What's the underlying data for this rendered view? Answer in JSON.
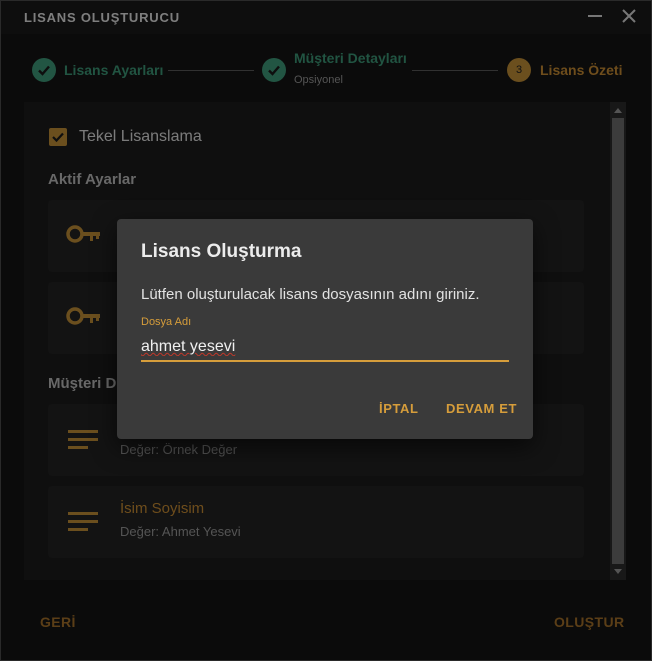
{
  "window": {
    "title": "LISANS OLUŞTURUCU"
  },
  "stepper": {
    "steps": [
      {
        "label": "Lisans Ayarları",
        "status": "done"
      },
      {
        "label": "Müşteri Detayları",
        "sub": "Opsiyonel",
        "status": "done"
      },
      {
        "label": "Lisans Özeti",
        "number": "3",
        "status": "active"
      }
    ]
  },
  "content": {
    "checkbox_label": "Tekel Lisanslama",
    "checkbox_checked": true,
    "active_settings_title": "Aktif Ayarlar",
    "customer_details_title": "Müşteri Detayları",
    "customer_cards": [
      {
        "title": "",
        "value": "Değer: Örnek Değer",
        "icon": "notes-icon"
      },
      {
        "title": "İsim Soyisim",
        "value": "Değer: Ahmet Yesevi",
        "icon": "notes-icon"
      }
    ],
    "settings_cards": [
      {
        "icon": "key-icon"
      },
      {
        "icon": "key-icon"
      }
    ]
  },
  "dialog": {
    "title": "Lisans Oluşturma",
    "message": "Lütfen oluşturulacak lisans dosyasının adını giriniz.",
    "field_label": "Dosya Adı",
    "field_value": "ahmet yesevi",
    "cancel_label": "İPTAL",
    "continue_label": "DEVAM ET"
  },
  "footer": {
    "back_label": "GERİ",
    "create_label": "OLUŞTUR"
  },
  "colors": {
    "accent": "#d69d3b",
    "success": "#3f9b7a",
    "background": "#141414",
    "dialog": "#3a3a3a"
  }
}
